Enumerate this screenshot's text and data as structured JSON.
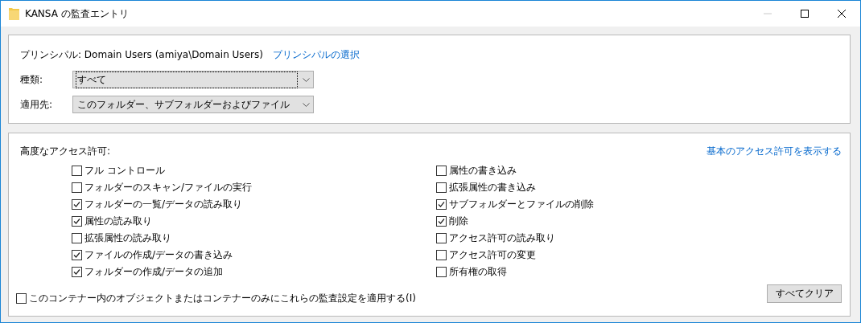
{
  "window": {
    "title": "KANSA の監査エントリ",
    "controls": [
      {
        "kind": "minimize",
        "disabled": true
      },
      {
        "kind": "maximize",
        "disabled": false
      },
      {
        "kind": "close",
        "disabled": false
      }
    ]
  },
  "principal": {
    "label": "プリンシパル:",
    "value": "Domain Users (amiya\\Domain Users)",
    "link": "プリンシパルの選択"
  },
  "fields": [
    {
      "label": "種類:",
      "value": "すべて",
      "focused": true
    },
    {
      "label": "適用先:",
      "value": "このフォルダー、サブフォルダーおよびファイル",
      "focused": false
    }
  ],
  "permissions": {
    "title": "高度なアクセス許可:",
    "link": "基本のアクセス許可を表示する",
    "columns": [
      [
        {
          "label": "フル コントロール",
          "checked": false
        },
        {
          "label": "フォルダーのスキャン/ファイルの実行",
          "checked": false
        },
        {
          "label": "フォルダーの一覧/データの読み取り",
          "checked": true
        },
        {
          "label": "属性の読み取り",
          "checked": true
        },
        {
          "label": "拡張属性の読み取り",
          "checked": false
        },
        {
          "label": "ファイルの作成/データの書き込み",
          "checked": true
        },
        {
          "label": "フォルダーの作成/データの追加",
          "checked": true
        }
      ],
      [
        {
          "label": "属性の書き込み",
          "checked": false
        },
        {
          "label": "拡張属性の書き込み",
          "checked": false
        },
        {
          "label": "サブフォルダーとファイルの削除",
          "checked": true
        },
        {
          "label": "削除",
          "checked": true
        },
        {
          "label": "アクセス許可の読み取り",
          "checked": false
        },
        {
          "label": "アクセス許可の変更",
          "checked": false
        },
        {
          "label": "所有権の取得",
          "checked": false
        }
      ]
    ]
  },
  "apply_only": {
    "label": "このコンテナー内のオブジェクトまたはコンテナーのみにこれらの監査設定を適用する(I)",
    "checked": false
  },
  "buttons": [
    "すべてクリア"
  ]
}
